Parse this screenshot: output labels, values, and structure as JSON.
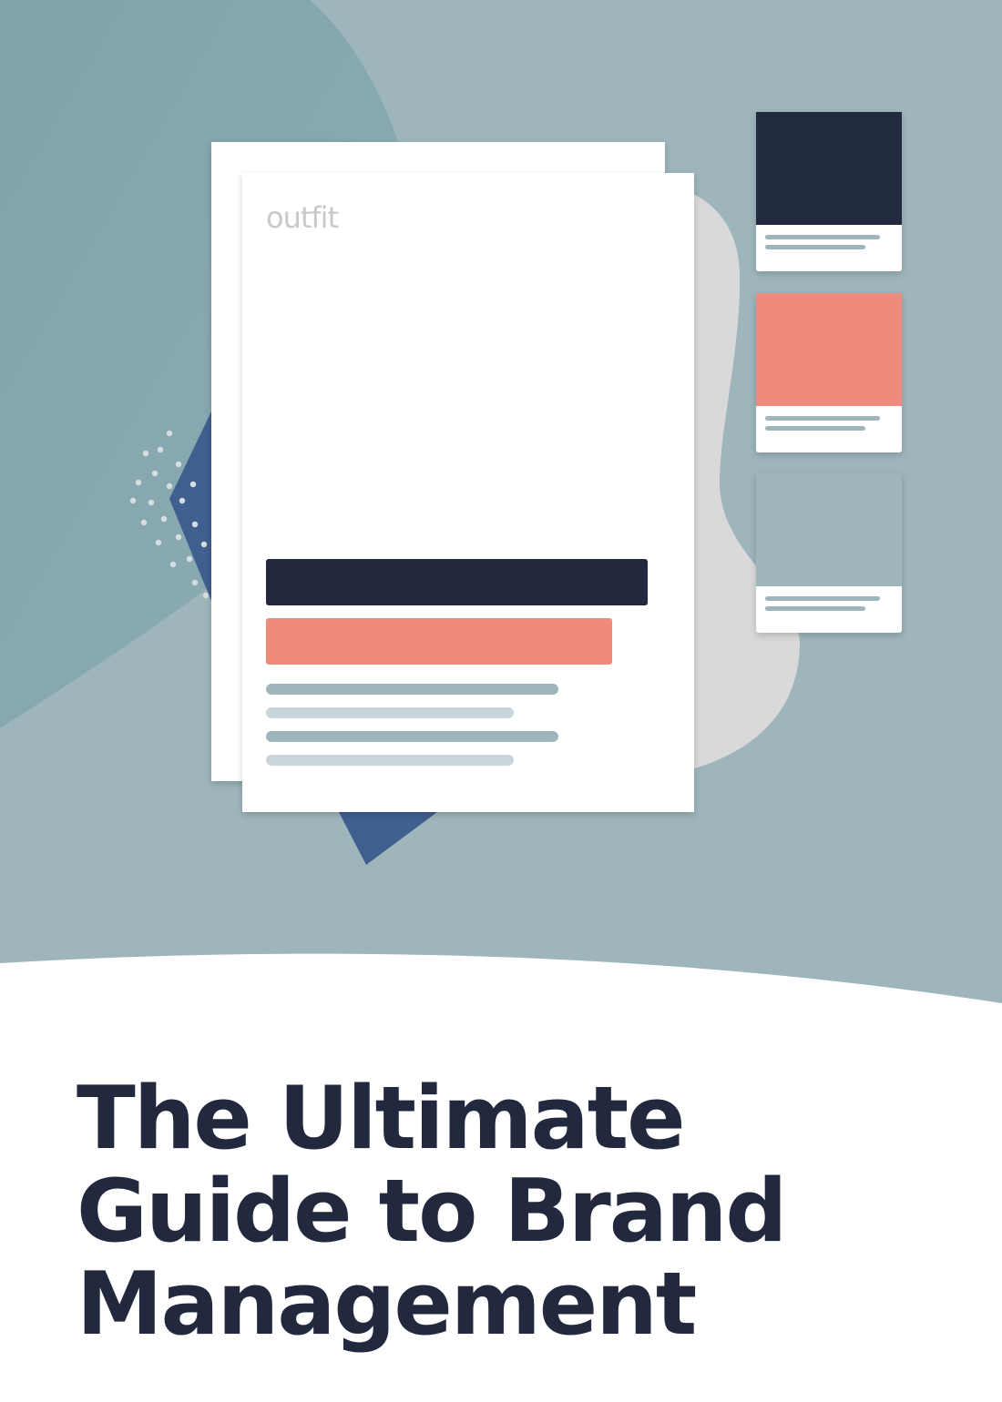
{
  "document": {
    "logo_text": "outfit",
    "title_lines": [
      "The Ultimate",
      "Guide to Brand",
      "Management"
    ]
  },
  "colors": {
    "background_teal": "#9db5bb",
    "background_dark_teal": "#7fa3ab",
    "navy": "#22293f",
    "coral": "#ef8b7b",
    "blue_diamond": "#3f5f8f",
    "grey_blob": "#d9d9d9",
    "line_teal": "#9db5bb",
    "line_light": "#c8d6da",
    "white": "#ffffff"
  },
  "illustration": {
    "swatch_cards": [
      "navy",
      "coral",
      "teal"
    ]
  }
}
